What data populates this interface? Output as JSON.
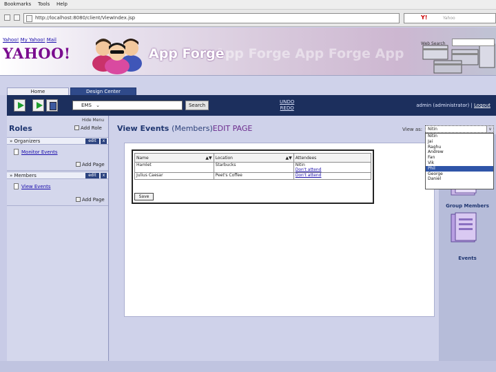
{
  "browser": {
    "menu": [
      "Bookmarks",
      "Tools",
      "Help"
    ],
    "url": "http://localhost:8080/client/ViewIndex.jsp",
    "search_logo": "Y!",
    "search_placeholder": "Yahoo"
  },
  "header": {
    "yahoo_links": [
      "Yahoo!",
      "My Yahoo!",
      "Mail"
    ],
    "yahoo_logo": "YAHOO!",
    "app_name": "App Forge",
    "app_ghost": "App Forge App Forge App",
    "web_search_label": "Web Search"
  },
  "tabs": [
    {
      "label": "Home"
    },
    {
      "label": "Design Center"
    }
  ],
  "toolbar": {
    "page_select": "EMS",
    "search_label": "Search",
    "undo": "UNDO",
    "redo": "REDO",
    "user": "admin (administrator)",
    "logout": "Logout"
  },
  "sidebar": {
    "hide_menu": "Hide Menu",
    "title": "Roles",
    "add_role": "Add Role",
    "roles": [
      {
        "name": "Organizers",
        "edit": "edit",
        "x": "x",
        "page": "Monitor Events",
        "add_page": "Add Page"
      },
      {
        "name": "Members",
        "edit": "edit",
        "x": "x",
        "page": "View Events",
        "add_page": "Add Page"
      }
    ]
  },
  "main": {
    "title": "View Events",
    "title_role": "(Members)",
    "title_action": "EDIT PAGE",
    "view_as_label": "View as:",
    "view_as_value": "Nitin",
    "view_as_arrow": "v",
    "view_as_options": [
      "Nitin",
      "Jai",
      "Raghu",
      "Andrew",
      "Fan",
      "Vik",
      "Phil",
      "George",
      "Daniel"
    ],
    "view_as_selected": "Phil",
    "grid": {
      "columns": [
        "Name",
        "Location",
        "Attendees"
      ],
      "sort_arrows": "▲▼",
      "rows": [
        {
          "name": "Hamlet",
          "location": "Starbucks",
          "attendees": "Nitin",
          "link": "Don't attend"
        },
        {
          "name": "Julius Caesar",
          "location": "Peet's Coffee",
          "attendees": "",
          "link": "Don't attend"
        }
      ],
      "save_label": "Save"
    }
  },
  "right_panel": {
    "items": [
      {
        "label": "Group Members"
      },
      {
        "label": "Events"
      }
    ]
  },
  "colors": {
    "navy": "#1c2f5d",
    "accent_purple": "#6b2a8c",
    "background": "#cfd2ea"
  }
}
